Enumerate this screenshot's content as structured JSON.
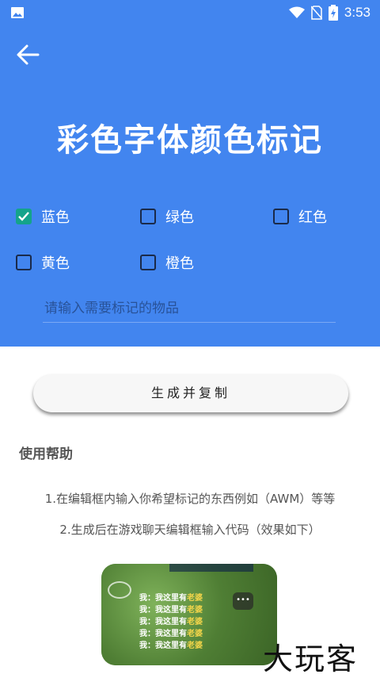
{
  "status": {
    "time": "3:53"
  },
  "header": {
    "title": "彩色字体颜色标记"
  },
  "colors": [
    {
      "label": "蓝色",
      "checked": true
    },
    {
      "label": "绿色",
      "checked": false
    },
    {
      "label": "红色",
      "checked": false
    },
    {
      "label": "黄色",
      "checked": false
    },
    {
      "label": "橙色",
      "checked": false
    }
  ],
  "input": {
    "placeholder": "请输入需要标记的物品",
    "value": ""
  },
  "button": {
    "label": "生成并复制"
  },
  "help": {
    "title": "使用帮助",
    "line1": "1.在编辑框内输入你希望标记的东西例如（AWM）等等",
    "line2": "2.生成后在游戏聊天编辑框输入代码（效果如下）"
  },
  "preview": {
    "lines": [
      {
        "prefix": "我：我这里有",
        "highlight": "老婆"
      },
      {
        "prefix": "我：我这里有",
        "highlight": "老婆"
      },
      {
        "prefix": "我：我这里有",
        "highlight": "老婆"
      },
      {
        "prefix": "我：我这里有",
        "highlight": "老婆"
      },
      {
        "prefix": "我：我这里有",
        "highlight": "老婆"
      }
    ],
    "bubble": "•••"
  },
  "watermark": "大玩客",
  "palette": {
    "header_bg": "#4285ef",
    "check": "#14a38b"
  }
}
